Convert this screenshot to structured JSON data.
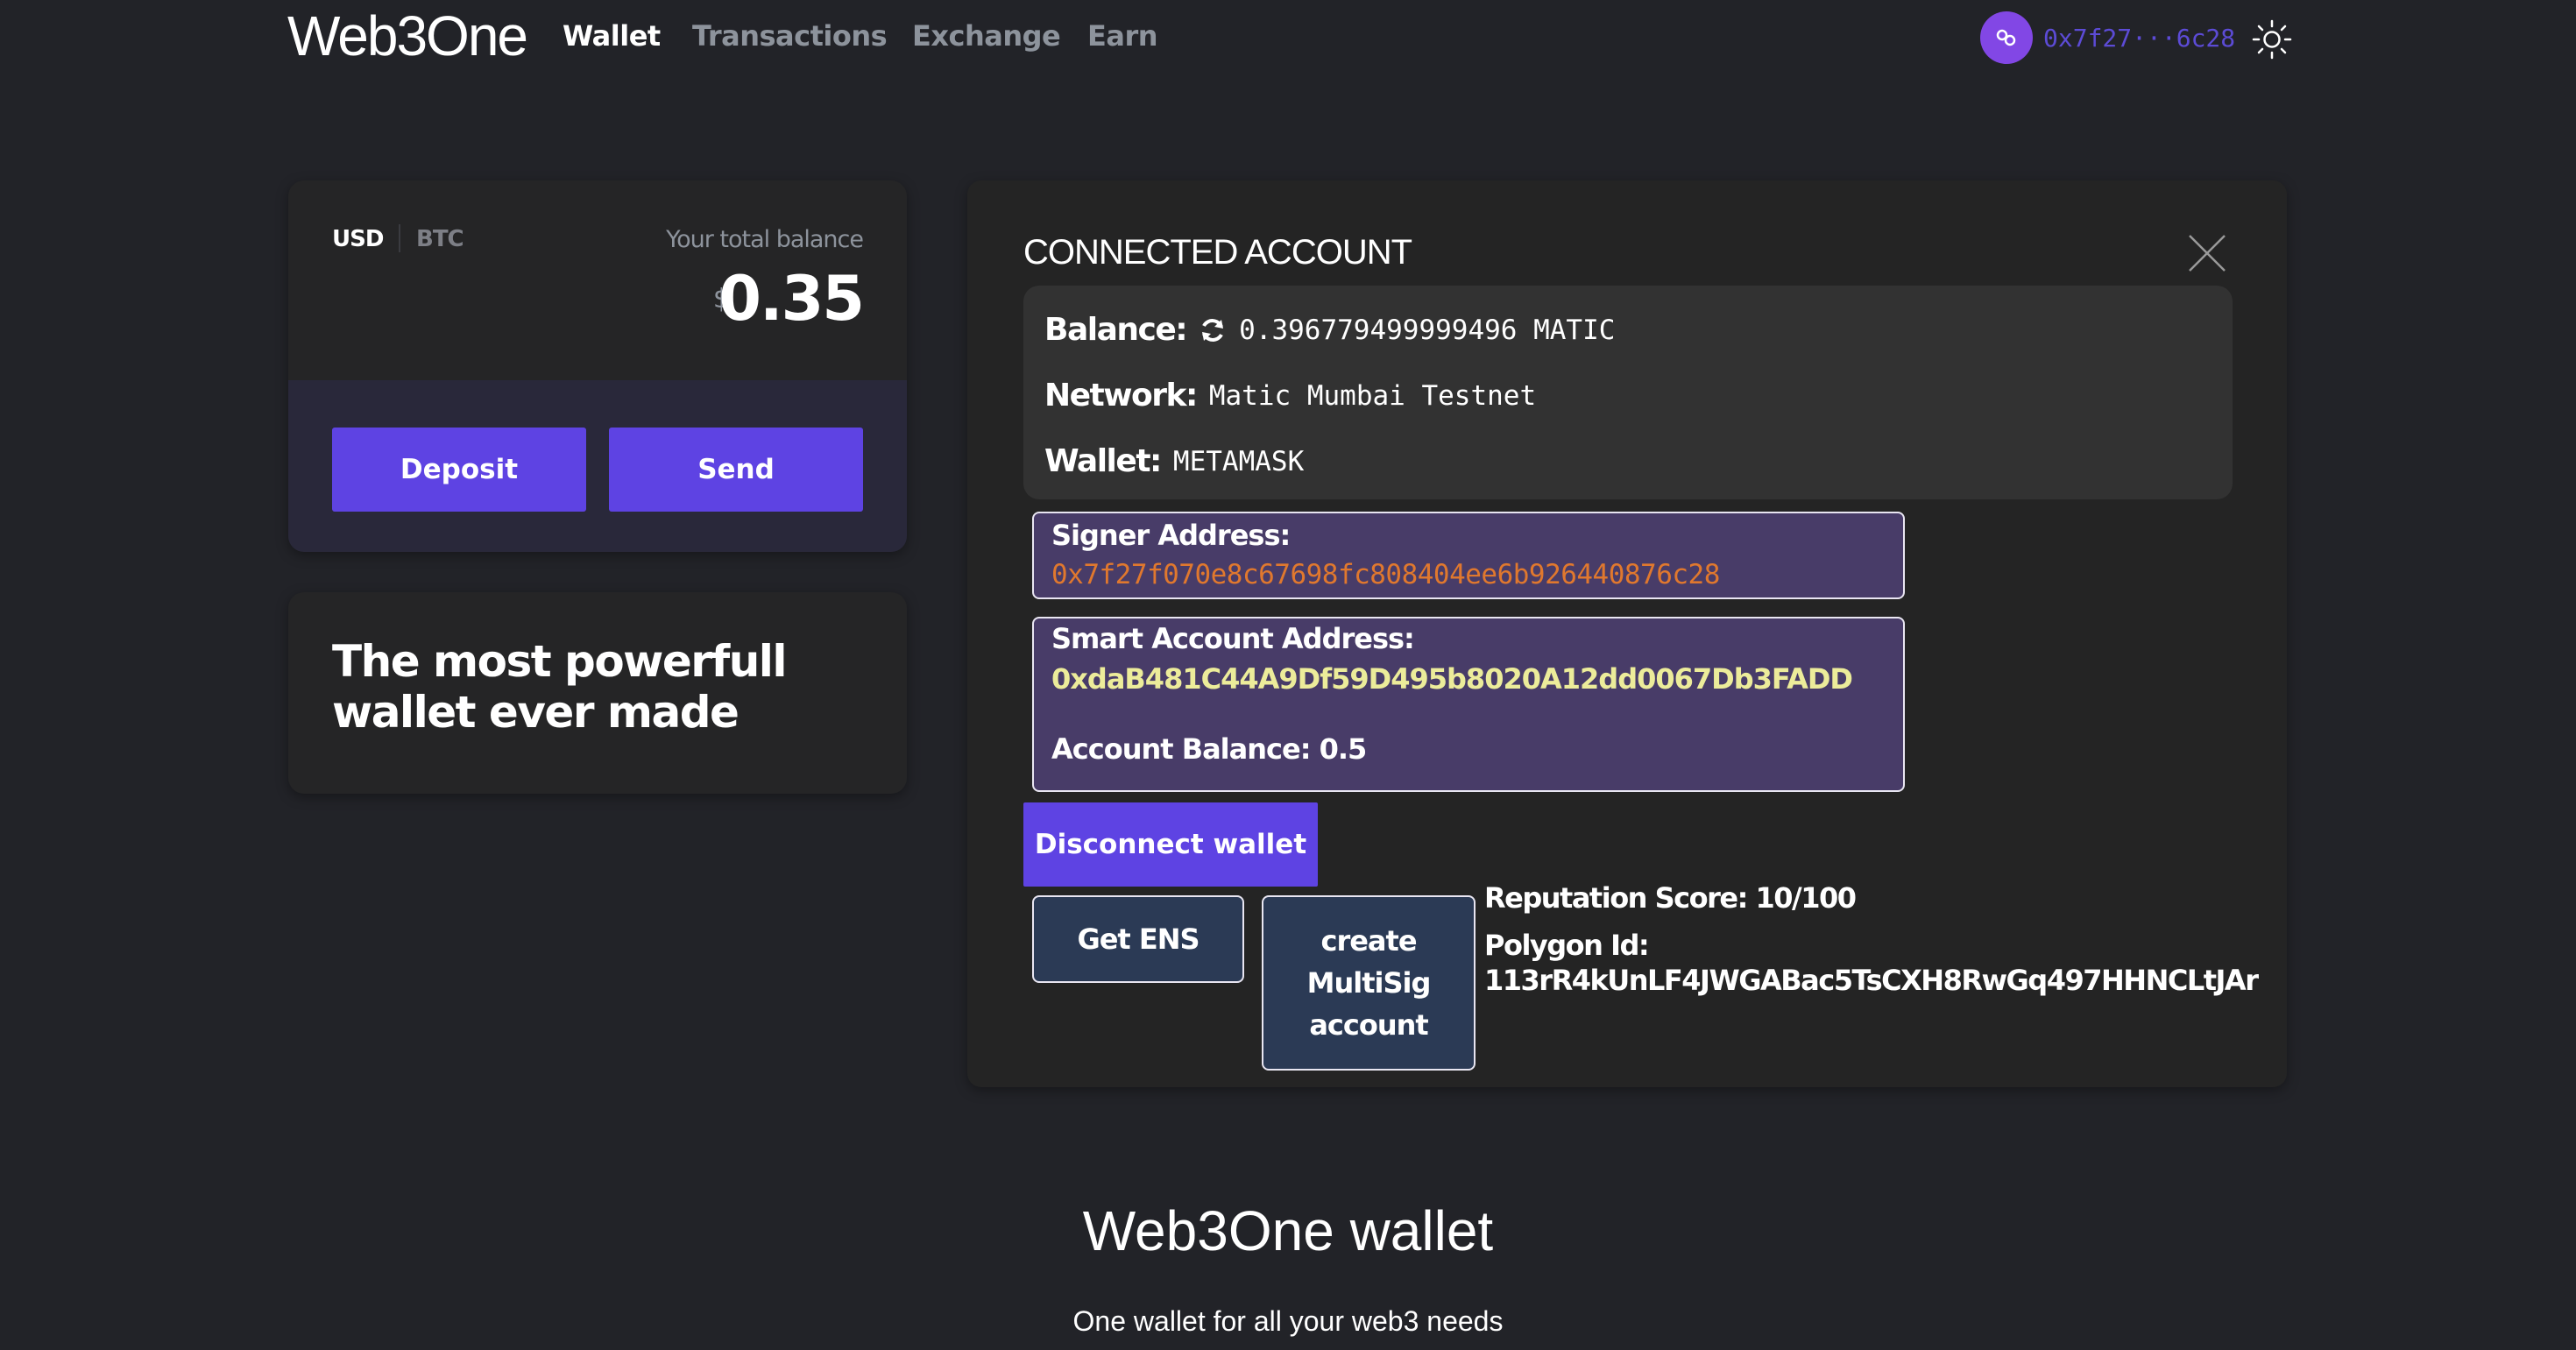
{
  "nav": {
    "logo": "Web3One",
    "links": [
      "Wallet",
      "Transactions",
      "Exchange",
      "Earn"
    ],
    "active_link": "Wallet",
    "account_short": "0x7f27···6c28",
    "chain_icon": "polygon-icon",
    "theme_icon": "sun-icon"
  },
  "balance_card": {
    "currency_tabs": [
      "USD",
      "BTC"
    ],
    "selected_currency": "USD",
    "total_label": "Your total balance",
    "currency_symbol": "$",
    "amount": "0.35",
    "deposit_label": "Deposit",
    "send_label": "Send"
  },
  "tagline_card": {
    "line1": "The most powerfull",
    "line2": "wallet ever made"
  },
  "connected_account": {
    "title": "CONNECTED ACCOUNT",
    "balance_label": "Balance:",
    "balance_value": "0.396779499999496 MATIC",
    "network_label": "Network:",
    "network_value": "Matic Mumbai Testnet",
    "wallet_label": "Wallet:",
    "wallet_value": "METAMASK",
    "signer_label": "Signer Address:",
    "signer_address": "0x7f27f070e8c67698fc808404ee6b926440876c28",
    "smart_label": "Smart Account Address:",
    "smart_address": "0xdaB481C44A9Df59D495b8020A12dd0067Db3FADD",
    "account_balance": "Account Balance: 0.5",
    "disconnect_label": "Disconnect wallet",
    "ens_label": "Get ENS",
    "multisig_label": "create MultiSig account",
    "reputation": "Reputation Score: 10/100",
    "polygon_id_label": "Polygon Id:",
    "polygon_id_value": "113rR4kUnLF4JWGABac5TsCXH8RwGq497HHNCLtJAr"
  },
  "hero": {
    "title": "Web3One wallet",
    "subtitle": "One wallet for all your web3 needs"
  },
  "colors": {
    "accent": "#5e43e3",
    "polygon": "#8247e5",
    "signer_address": "#e0782e",
    "smart_address": "#ecec9a",
    "address_box": "#483c68"
  }
}
